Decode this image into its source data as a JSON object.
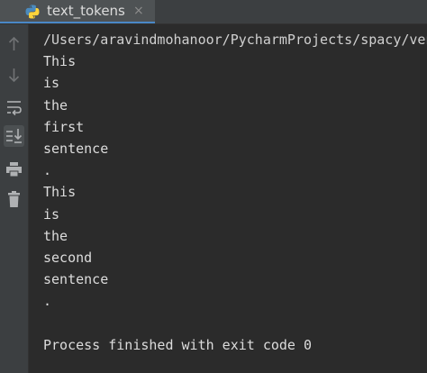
{
  "tab": {
    "title": "text_tokens",
    "close_glyph": "×",
    "icon": "python-icon"
  },
  "toolbar": {
    "buttons": [
      {
        "icon": "arrow-up-icon"
      },
      {
        "icon": "arrow-down-icon"
      },
      {
        "icon": "soft-wrap-icon"
      },
      {
        "icon": "scroll-to-end-icon"
      },
      {
        "icon": "print-icon"
      },
      {
        "icon": "trash-icon"
      }
    ]
  },
  "console": {
    "path": "/Users/aravindmohanoor/PycharmProjects/spacy/venv/bin/python",
    "lines": [
      "This",
      "is",
      "the",
      "first",
      "sentence",
      ".",
      "This",
      "is",
      "the",
      "second",
      "sentence",
      "."
    ],
    "blank": "",
    "exit_message": "Process finished with exit code 0"
  },
  "colors": {
    "background": "#2b2b2b",
    "panel": "#3c3f41",
    "text": "#dcdcdc",
    "accent": "#4a88c7"
  }
}
